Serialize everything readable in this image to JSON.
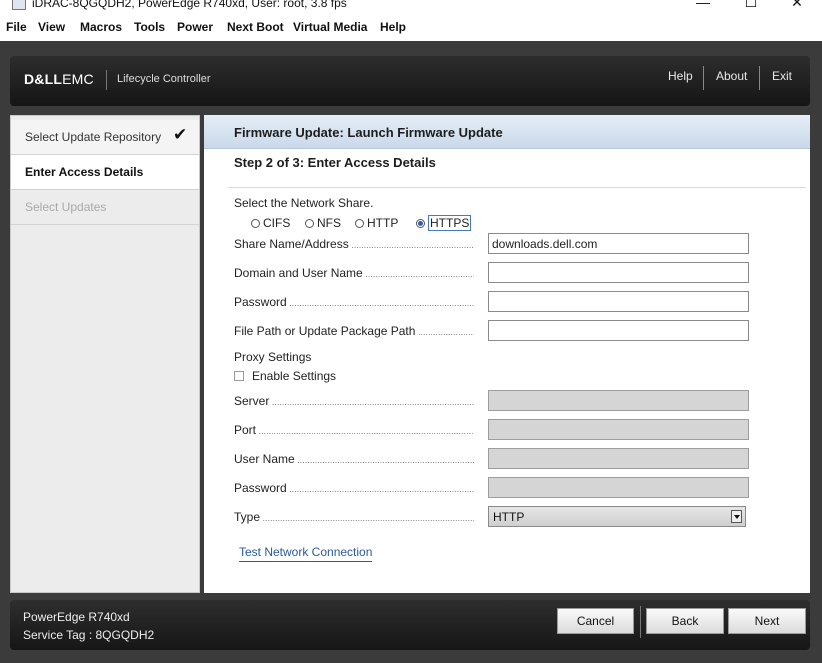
{
  "window": {
    "title": "iDRAC-8QGQDH2, PowerEdge R740xd, User: root, 3.8 fps",
    "minimize": "—",
    "maximize": "☐",
    "close": "✕"
  },
  "menubar": [
    "File",
    "View",
    "Macros",
    "Tools",
    "Power",
    "Next Boot",
    "Virtual Media",
    "Help"
  ],
  "header": {
    "logo_brand": "D&LL",
    "logo_suffix": "EMC",
    "product": "Lifecycle Controller",
    "links": [
      "Help",
      "About",
      "Exit"
    ]
  },
  "nav": {
    "items": [
      {
        "label": "Select Update Repository",
        "state": "done"
      },
      {
        "label": "Enter Access Details",
        "state": "active"
      },
      {
        "label": "Select Updates",
        "state": "disabled"
      }
    ],
    "check_icon": "check-icon"
  },
  "main": {
    "title": "Firmware Update: Launch Firmware Update",
    "step": "Step 2 of 3: Enter Access Details",
    "network_share_prompt": "Select the Network Share.",
    "share_types": [
      "CIFS",
      "NFS",
      "HTTP",
      "HTTPS"
    ],
    "selected_share_type": "HTTPS",
    "fields": {
      "share_name_label": "Share Name/Address",
      "share_name_value": "downloads.dell.com",
      "domain_user_label": "Domain and User Name",
      "domain_user_value": "",
      "password_label": "Password",
      "password_value": "",
      "file_path_label": "File Path or Update Package Path",
      "file_path_value": ""
    },
    "proxy": {
      "heading": "Proxy Settings",
      "enable_label": "Enable Settings",
      "enabled": false,
      "server_label": "Server",
      "port_label": "Port",
      "user_label": "User Name",
      "password_label": "Password",
      "type_label": "Type",
      "type_value": "HTTP"
    },
    "test_link": "Test Network Connection"
  },
  "footer": {
    "model": "PowerEdge R740xd",
    "service_tag": "Service Tag : 8QGQDH2",
    "buttons": [
      "Cancel",
      "Back",
      "Next"
    ]
  }
}
